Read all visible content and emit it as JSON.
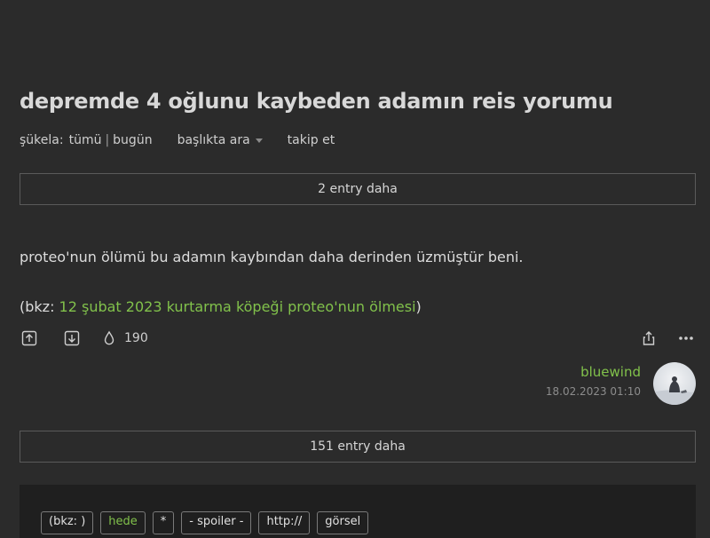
{
  "topic": {
    "title": "depremde 4 oğlunu kaybeden adamın reis yorumu"
  },
  "filters": {
    "label": "şükela:",
    "all": "tümü",
    "separator": "|",
    "today": "bugün",
    "search": "başlıkta ara",
    "follow": "takip et"
  },
  "more_top": {
    "label": "2 entry daha"
  },
  "entry": {
    "text": "proteo'nun ölümü bu adamın kaybından daha derinden üzmüştür beni.",
    "bkz_open": "(bkz: ",
    "bkz_link": "12 şubat 2023 kurtarma köpeği proteo'nun ölmesi",
    "bkz_close": ")",
    "favorite_count": "190",
    "author": "bluewind",
    "date": "18.02.2023 01:10"
  },
  "more_bottom": {
    "label": "151 entry daha"
  },
  "editor_toolbar": {
    "buttons": [
      "(bkz: )",
      "hede",
      "*",
      "- spoiler -",
      "http://",
      "görsel"
    ]
  },
  "icons": {
    "upvote": "arrow-up-box-icon",
    "downvote": "arrow-down-box-icon",
    "favorite": "droplet-icon",
    "share": "share-icon",
    "more": "ellipsis-icon"
  },
  "colors": {
    "background": "#2b2b2b",
    "accent": "#81c14b",
    "border": "#5a5a5a",
    "editor_bg": "#1f1f1f"
  }
}
